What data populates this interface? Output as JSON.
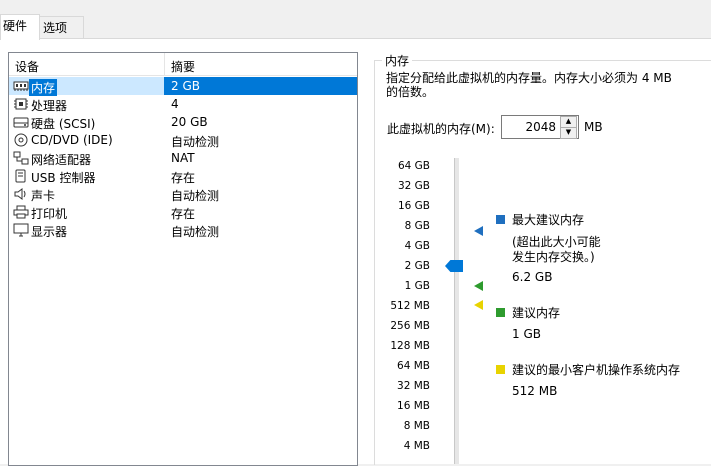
{
  "tabs": [
    {
      "label": "硬件",
      "active": true
    },
    {
      "label": "选项",
      "active": false
    }
  ],
  "device_table": {
    "columns": [
      "设备",
      "摘要"
    ],
    "rows": [
      {
        "icon": "memory-icon",
        "name": "内存",
        "summary": "2 GB",
        "selected": true
      },
      {
        "icon": "processor-icon",
        "name": "处理器",
        "summary": "4"
      },
      {
        "icon": "harddisk-icon",
        "name": "硬盘 (SCSI)",
        "summary": "20 GB"
      },
      {
        "icon": "cd-dvd-icon",
        "name": "CD/DVD (IDE)",
        "summary": "自动检测"
      },
      {
        "icon": "network-adapter-icon",
        "name": "网络适配器",
        "summary": "NAT"
      },
      {
        "icon": "usb-icon",
        "name": "USB 控制器",
        "summary": "存在"
      },
      {
        "icon": "sound-card-icon",
        "name": "声卡",
        "summary": "自动检测"
      },
      {
        "icon": "printer-icon",
        "name": "打印机",
        "summary": "存在"
      },
      {
        "icon": "display-icon",
        "name": "显示器",
        "summary": "自动检测"
      }
    ]
  },
  "memory": {
    "group_title": "内存",
    "description": "指定分配给此虚拟机的内存量。内存大小必须为 4 MB 的倍数。",
    "label": "此虚拟机的内存(M):",
    "value": "2048",
    "unit": "MB",
    "scale_ticks": [
      "64 GB",
      "32 GB",
      "16 GB",
      "8 GB",
      "4 GB",
      "2 GB",
      "1 GB",
      "512 MB",
      "256 MB",
      "128 MB",
      "64 MB",
      "32 MB",
      "16 MB",
      "8 MB",
      "4 MB"
    ],
    "legend": {
      "max": {
        "title": "最大建议内存",
        "note1": "(超出此大小可能",
        "note2": "发生内存交换。)",
        "value": "6.2 GB",
        "color": "#1f6fbf"
      },
      "recommended": {
        "title": "建议内存",
        "value": "1 GB",
        "color": "#2e9b2e"
      },
      "min_guest": {
        "title": "建议的最小客户机操作系统内存",
        "value": "512 MB",
        "color": "#e8d300"
      }
    }
  }
}
